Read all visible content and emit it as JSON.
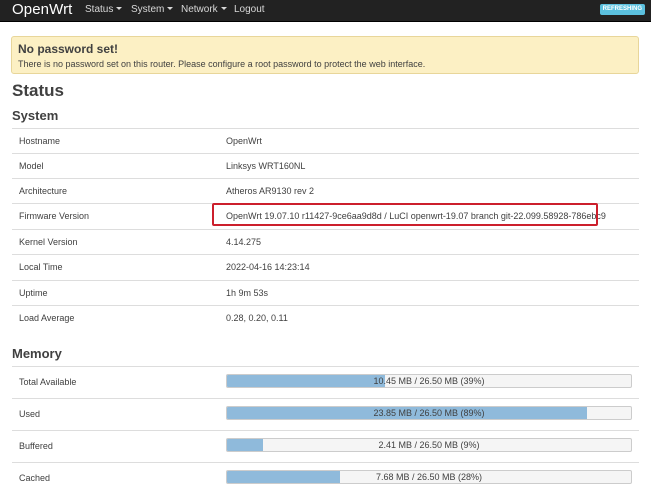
{
  "navbar": {
    "brand": "OpenWrt",
    "menu": [
      {
        "label": "Status",
        "dropdown": true
      },
      {
        "label": "System",
        "dropdown": true
      },
      {
        "label": "Network",
        "dropdown": true
      },
      {
        "label": "Logout",
        "dropdown": false
      }
    ],
    "badge": "REFRESHING",
    "badge_color": "#5bc0de"
  },
  "alert": {
    "title": "No password set!",
    "text": "There is no password set on this router. Please configure a root password to protect the web interface."
  },
  "page_title": "Status",
  "system": {
    "heading": "System",
    "rows": [
      {
        "key": "Hostname",
        "value": "OpenWrt"
      },
      {
        "key": "Model",
        "value": "Linksys WRT160NL"
      },
      {
        "key": "Architecture",
        "value": "Atheros AR9130 rev 2"
      },
      {
        "key": "Firmware Version",
        "value": "OpenWrt 19.07.10 r11427-9ce6aa9d8d / LuCI openwrt-19.07 branch git-22.099.58928-786ebc9"
      },
      {
        "key": "Kernel Version",
        "value": "4.14.275"
      },
      {
        "key": "Local Time",
        "value": "2022-04-16 14:23:14"
      },
      {
        "key": "Uptime",
        "value": "1h 9m 53s"
      },
      {
        "key": "Load Average",
        "value": "0.28, 0.20, 0.11"
      }
    ]
  },
  "memory": {
    "heading": "Memory",
    "rows": [
      {
        "key": "Total Available",
        "text": "10.45 MB / 26.50 MB (39%)",
        "percent": 39
      },
      {
        "key": "Used",
        "text": "23.85 MB / 26.50 MB (89%)",
        "percent": 89
      },
      {
        "key": "Buffered",
        "text": "2.41 MB / 26.50 MB (9%)",
        "percent": 9
      },
      {
        "key": "Cached",
        "text": "7.68 MB / 26.50 MB (28%)",
        "percent": 28
      }
    ]
  }
}
